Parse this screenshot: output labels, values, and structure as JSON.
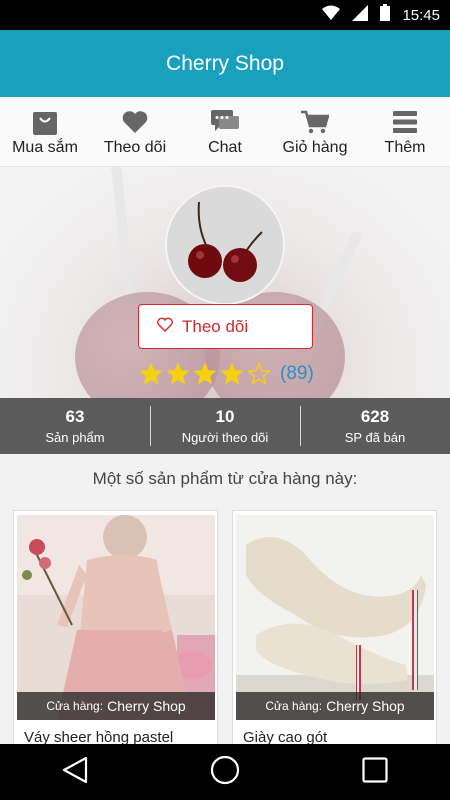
{
  "status_bar": {
    "time": "15:45",
    "icons": [
      "wifi-icon",
      "signal-icon",
      "battery-icon"
    ]
  },
  "app_bar": {
    "title": "Cherry Shop"
  },
  "tabs": [
    {
      "label": "Mua sắm",
      "icon": "shopping-bag-icon"
    },
    {
      "label": "Theo dõi",
      "icon": "heart-icon"
    },
    {
      "label": "Chat",
      "icon": "chat-icon"
    },
    {
      "label": "Giỏ hàng",
      "icon": "cart-icon"
    },
    {
      "label": "Thêm",
      "icon": "menu-icon"
    }
  ],
  "shop": {
    "follow_label": "Theo dõi",
    "rating": 4,
    "rating_max": 5,
    "rating_count": "(89)"
  },
  "stats": [
    {
      "value": "63",
      "label": "Sản phẩm"
    },
    {
      "value": "10",
      "label": "Người theo dõi"
    },
    {
      "value": "628",
      "label": "SP đã bán"
    }
  ],
  "section_title": "Một số sản phẩm từ cửa hàng này:",
  "products": [
    {
      "shop_prefix": "Cửa hàng:",
      "shop_name": "Cherry Shop",
      "name": "Váy sheer hồng pastel"
    },
    {
      "shop_prefix": "Cửa hàng:",
      "shop_name": "Cherry Shop",
      "name": "Giày cao gót"
    }
  ],
  "colors": {
    "primary": "#1aa0bf",
    "follow_red": "#d12a2a",
    "star_yellow": "#f5d20f",
    "rating_blue": "#2b8fc4",
    "stats_bg": "#5b5b5b"
  }
}
